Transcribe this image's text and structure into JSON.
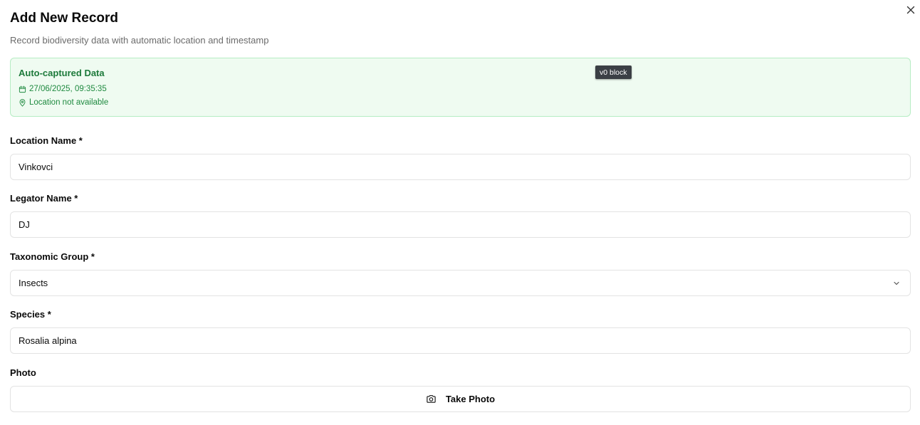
{
  "dialog": {
    "title": "Add New Record",
    "subtitle": "Record biodiversity data with automatic location and timestamp",
    "close_icon": "close-icon"
  },
  "auto_captured": {
    "heading": "Auto-captured Data",
    "timestamp": "27/06/2025, 09:35:35",
    "timestamp_icon": "calendar-icon",
    "location": "Location not available",
    "location_icon": "map-pin-icon",
    "accent_color": "#1f8a40",
    "background_color": "#effbf1"
  },
  "badge": {
    "text": "v0 block"
  },
  "form": {
    "location_name": {
      "label": "Location Name *",
      "value": "Vinkovci"
    },
    "legator_name": {
      "label": "Legator Name *",
      "value": "DJ"
    },
    "taxonomic_group": {
      "label": "Taxonomic Group *",
      "value": "Insects",
      "icon": "chevron-down-icon"
    },
    "species": {
      "label": "Species *",
      "value": "Rosalia alpina"
    },
    "photo": {
      "label": "Photo",
      "button_label": "Take Photo",
      "icon": "camera-icon"
    }
  }
}
